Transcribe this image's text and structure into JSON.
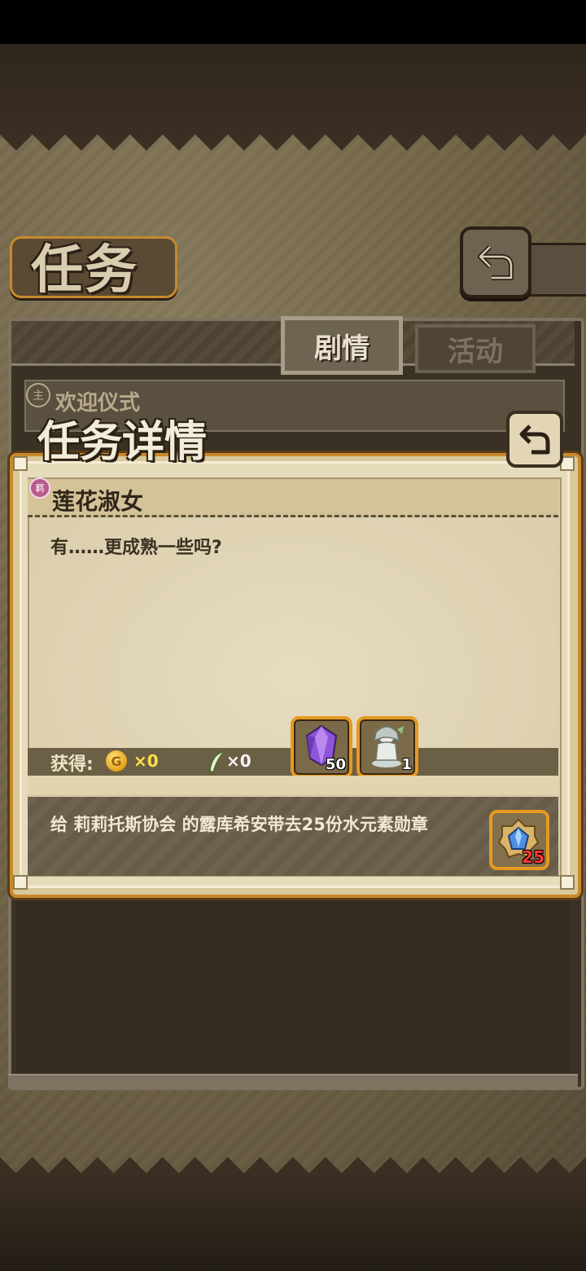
{
  "header": {
    "title": "任务",
    "back_icon": "return-arrow-icon"
  },
  "tabs": [
    {
      "label": "剧情",
      "active": true
    },
    {
      "label": "活动",
      "active": false
    }
  ],
  "list": {
    "items": [
      {
        "badge": "主",
        "title": "欢迎仪式"
      }
    ]
  },
  "dialog": {
    "title": "任务详情",
    "back_icon": "return-arrow-icon",
    "quest": {
      "badge": "羁",
      "name": "莲花淑女",
      "description": "有……更成熟一些吗?"
    },
    "rewards": {
      "label": "获得:",
      "coin_symbol": "G",
      "coin_value": "×0",
      "feather_value": "×0",
      "items": [
        {
          "icon": "purple-crystal-icon",
          "count": "50"
        },
        {
          "icon": "character-figure-icon",
          "count": "1"
        }
      ]
    },
    "task": {
      "text": "给 莉莉托斯协会 的露库希安带去25份水元素勋章",
      "item_icon": "water-element-medal-icon",
      "item_count": "25"
    }
  },
  "colors": {
    "accent_orange": "#e69a1f",
    "coin_gold": "#ffe14a",
    "required_red": "#ff3636"
  }
}
